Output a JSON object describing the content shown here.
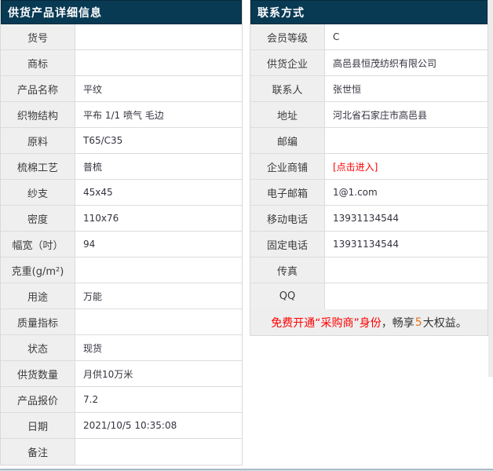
{
  "left_panel": {
    "title": "供货产品详细信息",
    "rows": [
      {
        "label": "货号",
        "value": ""
      },
      {
        "label": "商标",
        "value": ""
      },
      {
        "label": "产品名称",
        "value": "平纹"
      },
      {
        "label": "织物结构",
        "value": "平布 1/1 喷气 毛边"
      },
      {
        "label": "原料",
        "value": "T65/C35"
      },
      {
        "label": "梳棉工艺",
        "value": "普梳"
      },
      {
        "label": "纱支",
        "value": "45x45"
      },
      {
        "label": "密度",
        "value": "110x76"
      },
      {
        "label": "幅宽（吋）",
        "value": "94"
      },
      {
        "label": "克重(g/m²)",
        "value": ""
      },
      {
        "label": "用途",
        "value": "万能"
      },
      {
        "label": "质量指标",
        "value": ""
      },
      {
        "label": "状态",
        "value": "现货"
      },
      {
        "label": "供货数量",
        "value": "月供10万米"
      },
      {
        "label": "产品报价",
        "value": "7.2"
      },
      {
        "label": "日期",
        "value": "2021/10/5 10:35:08"
      },
      {
        "label": "备注",
        "value": ""
      }
    ]
  },
  "right_panel": {
    "title": "联系方式",
    "rows": [
      {
        "label": "会员等级",
        "value": "C"
      },
      {
        "label": "供货企业",
        "value": "高邑县恒茂纺织有限公司"
      },
      {
        "label": "联系人",
        "value": "张世恒"
      },
      {
        "label": "地址",
        "value": "河北省石家庄市高邑县"
      },
      {
        "label": "邮编",
        "value": ""
      },
      {
        "label": "企业商铺",
        "value": "[点击进入]",
        "link": true
      },
      {
        "label": "电子邮箱",
        "value": "1@1.com"
      },
      {
        "label": "移动电话",
        "value": "13931134544"
      },
      {
        "label": "固定电话",
        "value": "13931134544"
      },
      {
        "label": "传真",
        "value": ""
      },
      {
        "label": "QQ",
        "value": ""
      }
    ],
    "promo": {
      "red": "免费开通“采购商”身份",
      "mid": "，畅享",
      "num": "5",
      "tail": "大权益。"
    }
  },
  "colors": {
    "header_bg": "#093a54",
    "label_bg": "#efefef",
    "link_red": "#ff0000",
    "promo_num_orange": "#e8731a",
    "border": "#dcdcdc"
  }
}
